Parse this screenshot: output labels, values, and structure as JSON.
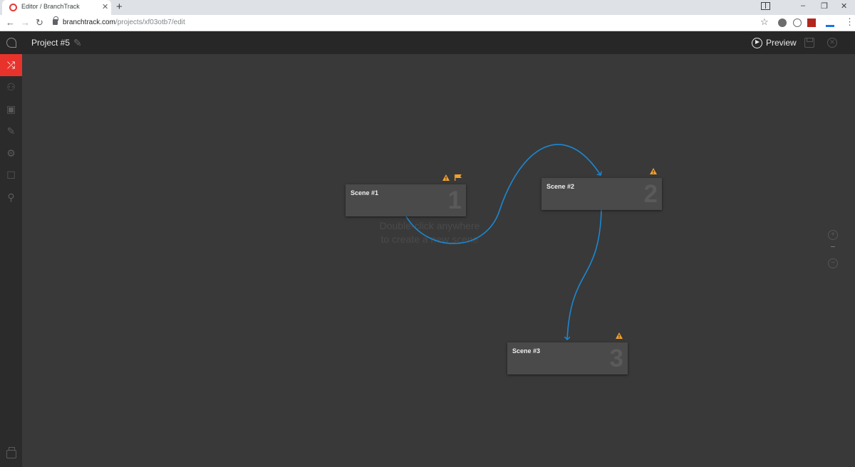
{
  "browser": {
    "tab_title": "Editor / BranchTrack",
    "url_host": "branchtrack.com",
    "url_path": "/projects/xf03otb7/edit",
    "new_tab": "+",
    "tab_close": "✕",
    "minimize": "–",
    "restore": "❐",
    "close": "✕"
  },
  "header": {
    "project_title": "Project #5",
    "preview_label": "Preview"
  },
  "sidebar": {
    "items": [
      {
        "icon": "shuffle-icon",
        "active": true
      },
      {
        "icon": "characters-icon",
        "active": false
      },
      {
        "icon": "backgrounds-icon",
        "active": false
      },
      {
        "icon": "pencil-icon",
        "active": false
      },
      {
        "icon": "integrations-icon",
        "active": false
      },
      {
        "icon": "comments-icon",
        "active": false
      },
      {
        "icon": "badge-icon",
        "active": false
      }
    ]
  },
  "canvas": {
    "hint_line1": "Double-click anywhere",
    "hint_line2": "to create a new scene",
    "link_color": "#1a88d4",
    "warning_color": "#f0a030"
  },
  "scenes": [
    {
      "title": "Scene #1",
      "number": "1",
      "has_warning": true,
      "has_flag": true
    },
    {
      "title": "Scene #2",
      "number": "2",
      "has_warning": true,
      "has_flag": false
    },
    {
      "title": "Scene #3",
      "number": "3",
      "has_warning": true,
      "has_flag": false
    }
  ],
  "zoom": {
    "in": "+",
    "out": "−"
  }
}
